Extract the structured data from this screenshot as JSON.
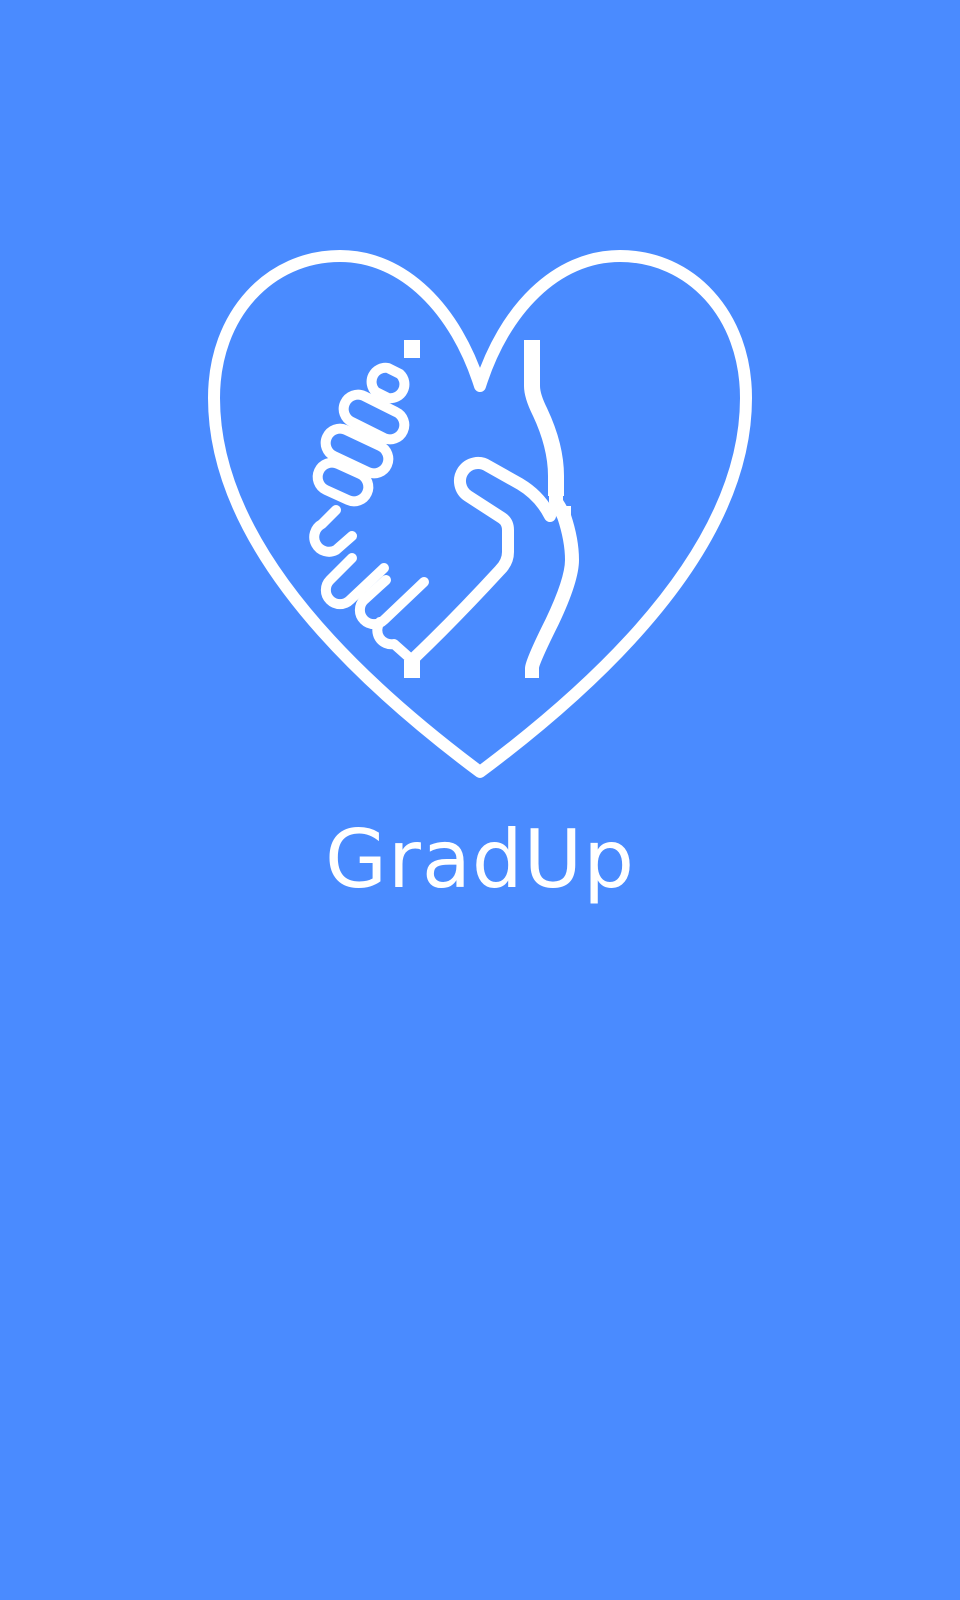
{
  "screen": {
    "background_color": "#4A8BFF",
    "foreground_color": "#FFFFFF"
  },
  "logo": {
    "icon": "heart-handshake-icon"
  },
  "app_name": "GradUp"
}
